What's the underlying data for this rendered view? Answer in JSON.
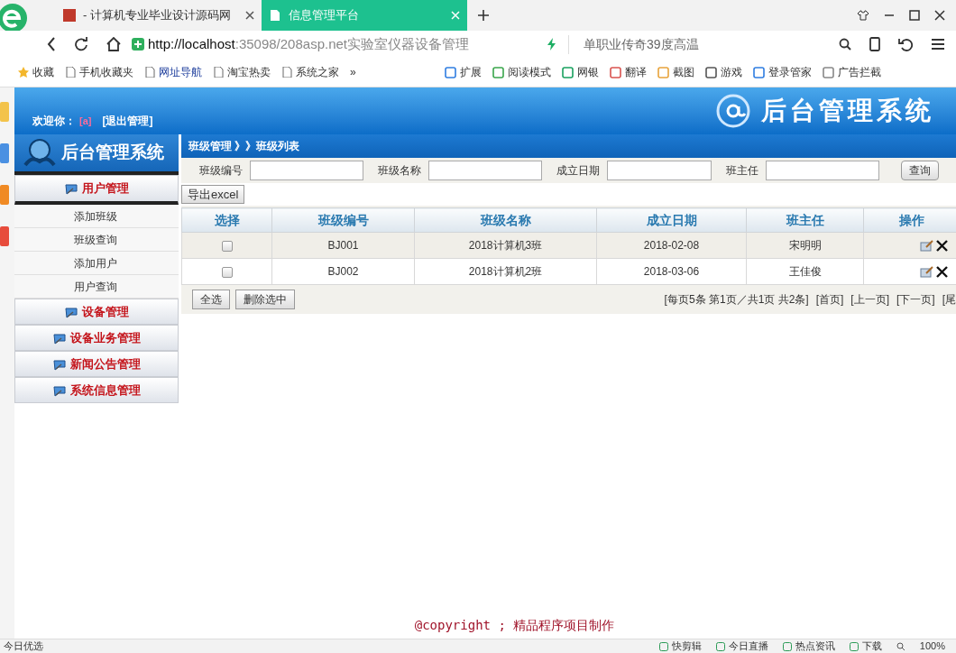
{
  "browser": {
    "tabs": [
      {
        "title": "- 计算机专业毕业设计源码网",
        "selected": false
      },
      {
        "title": "信息管理平台",
        "selected": true
      }
    ],
    "url_host": "http://localhost",
    "url_rest": ":35098/208asp.net实验室仪器设备管理",
    "search_hint": "单职业传奇39度高温",
    "bookmarks": [
      "收藏",
      "手机收藏夹",
      "网址导航",
      "淘宝热卖",
      "系统之家",
      "»"
    ],
    "tools": [
      "扩展",
      "阅读模式",
      "网银",
      "翻译",
      "截图",
      "游戏",
      "登录管家",
      "广告拦截"
    ]
  },
  "header": {
    "welcome": "欢迎你：",
    "user": "[a]",
    "logout": "[退出管理]",
    "title": "后台管理系统"
  },
  "sidebar": {
    "logo": "后台管理系统",
    "groups": [
      {
        "label": "用户管理",
        "expanded": true,
        "children": [
          "添加班级",
          "班级查询",
          "添加用户",
          "用户查询"
        ]
      },
      {
        "label": "设备管理",
        "expanded": false
      },
      {
        "label": "设备业务管理",
        "expanded": false
      },
      {
        "label": "新闻公告管理",
        "expanded": false
      },
      {
        "label": "系统信息管理",
        "expanded": false
      }
    ]
  },
  "breadcrumb": "班级管理 》》班级列表",
  "filters": [
    "班级编号",
    "班级名称",
    "成立日期",
    "班主任"
  ],
  "query_button": "查询",
  "export_button": "导出excel",
  "table": {
    "select_column": "选择",
    "columns": [
      "班级编号",
      "班级名称",
      "成立日期",
      "班主任"
    ],
    "action_column": "操作",
    "rows": [
      {
        "selected": false,
        "cells": [
          "BJ001",
          "2018计算机3班",
          "2018-02-08",
          "宋明明"
        ]
      },
      {
        "selected": false,
        "cells": [
          "BJ002",
          "2018计算机2班",
          "2018-03-06",
          "王佳俊"
        ]
      }
    ]
  },
  "actions": [
    "全选",
    "删除选中"
  ],
  "pagination": {
    "summary": "[每页5条 第1页／共1页 共2条]",
    "links": [
      "[首页]",
      "[上一页]",
      "[下一页]",
      "[尾"
    ]
  },
  "footer": "@copyright ; 精品程序项目制作",
  "status_bar": {
    "left": "今日优选",
    "items": [
      "快剪辑",
      "今日直播",
      "热点资讯",
      "下载"
    ],
    "zoom": "100%"
  }
}
